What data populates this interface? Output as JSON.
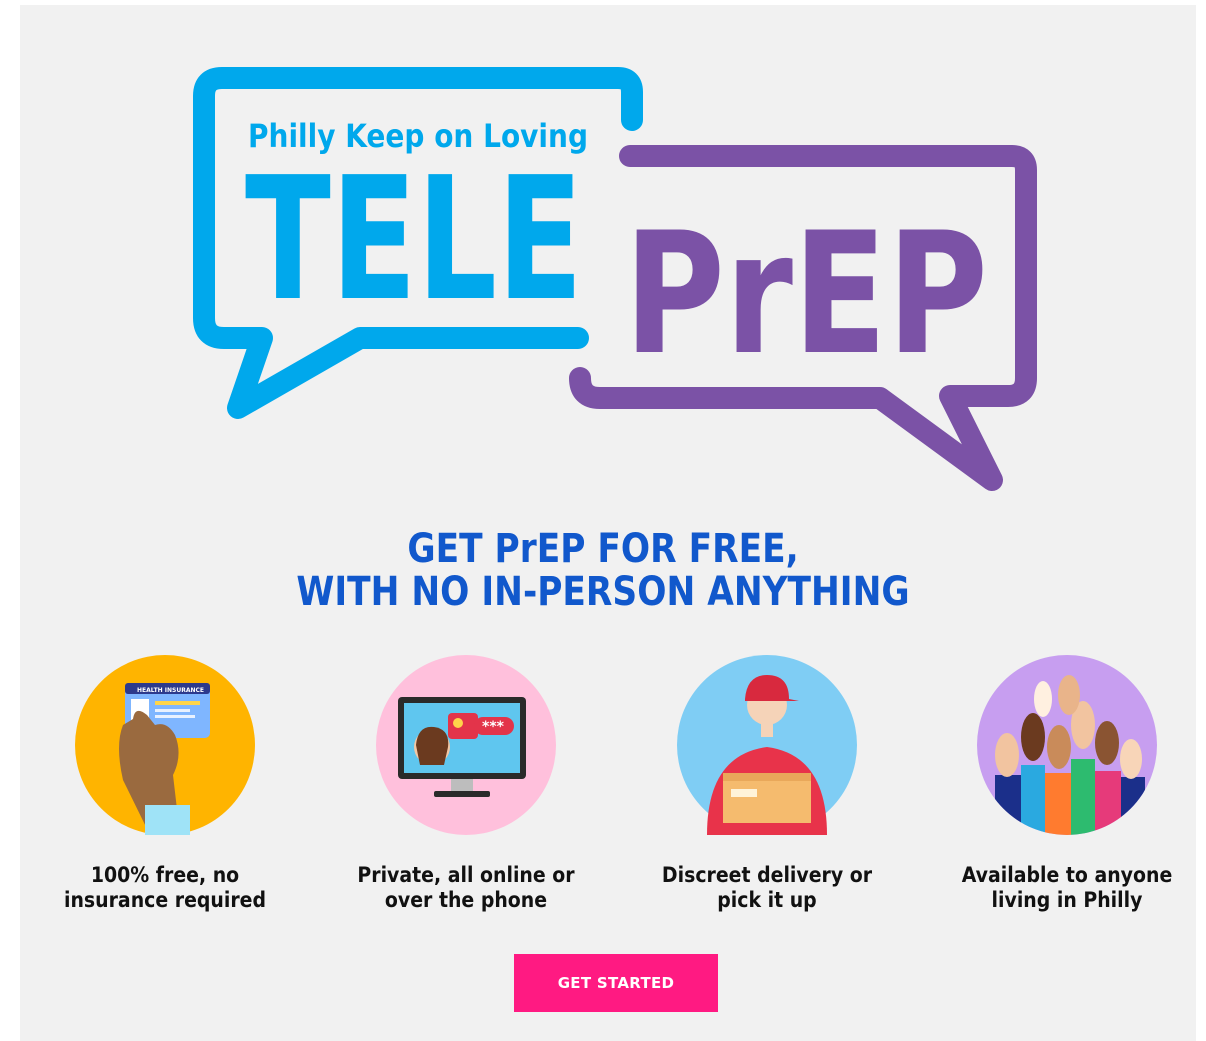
{
  "logo": {
    "subtitle": "Philly Keep on Loving",
    "word_left": "TELE",
    "word_right": "PrEP",
    "color_blue": "#00a8ec",
    "color_purple": "#7b52a6"
  },
  "headline": {
    "line1": "GET PrEP FOR FREE,",
    "line2": "WITH NO IN-PERSON ANYTHING",
    "color": "#1158cc"
  },
  "features": [
    {
      "icon": "health-insurance-card-icon",
      "caption": [
        "100% free, no",
        "insurance required"
      ],
      "bg": "#ffb400",
      "card_text": "HEALTH INSURANCE"
    },
    {
      "icon": "computer-privacy-icon",
      "caption": [
        "Private, all online or",
        "over the phone"
      ],
      "bg": "#ffc0dc",
      "bubble_text": "***"
    },
    {
      "icon": "delivery-person-icon",
      "caption": [
        "Discreet delivery or",
        "pick it up"
      ],
      "bg": "#7fcdf4"
    },
    {
      "icon": "raised-hands-icon",
      "caption": [
        "Available to anyone",
        "living in Philly"
      ],
      "bg": "#c79ef0"
    }
  ],
  "cta": {
    "label": "GET STARTED",
    "color": "#ff1a82"
  }
}
